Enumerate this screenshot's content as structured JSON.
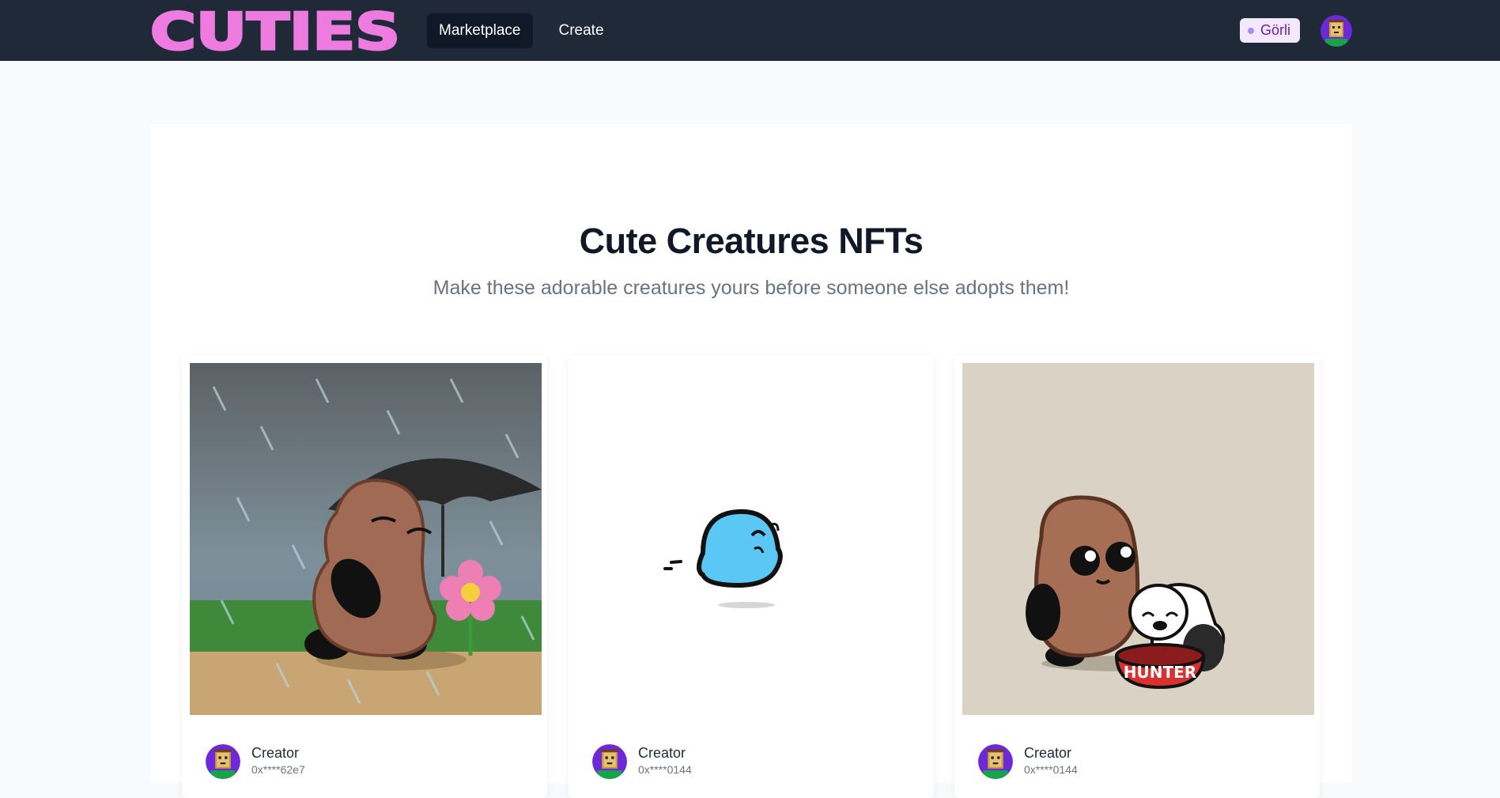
{
  "app": {
    "logo_text": "CUTIES"
  },
  "nav": {
    "links": [
      {
        "label": "Marketplace",
        "active": true
      },
      {
        "label": "Create",
        "active": false
      }
    ],
    "network_badge": "Görli"
  },
  "hero": {
    "title": "Cute Creatures NFTs",
    "subtitle": "Make these adorable creatures yours before someone else adopts them!"
  },
  "cards": [
    {
      "creator_label": "Creator",
      "creator_address": "0x****62e7",
      "image_icon": "rainy-creature-umbrella"
    },
    {
      "creator_label": "Creator",
      "creator_address": "0x****0144",
      "image_icon": "blue-blob-creature"
    },
    {
      "creator_label": "Creator",
      "creator_address": "0x****0144",
      "image_icon": "creature-with-dog",
      "bowl_text": "HUNTER"
    }
  ],
  "colors": {
    "navbar": "#1f2937",
    "logo": "#ee7be0",
    "badge_bg": "#f3e8ff",
    "badge_text": "#6b21a8"
  }
}
